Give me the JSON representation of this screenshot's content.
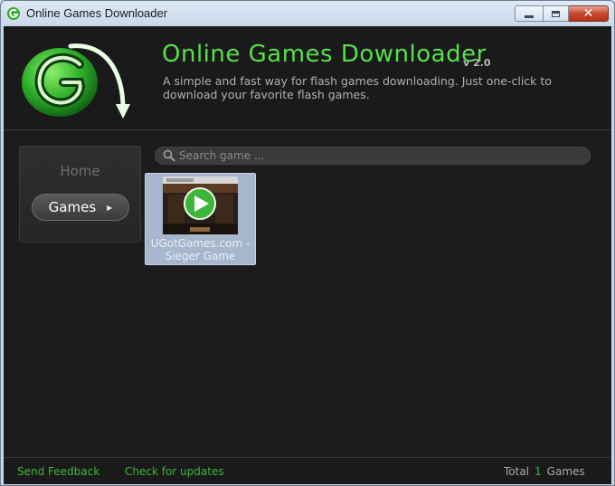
{
  "window": {
    "title": "Online Games Downloader"
  },
  "header": {
    "app_title": "Online Games Downloader",
    "version": "v 2.0",
    "tagline": "A simple and fast way for flash games downloading. Just one-click to download your favorite flash games.",
    "brand_color": "#57e04a"
  },
  "nav": {
    "items": [
      {
        "label": "Home",
        "active": false
      },
      {
        "label": "Games",
        "active": true
      }
    ]
  },
  "search": {
    "placeholder": "Search game ...",
    "value": ""
  },
  "games": [
    {
      "title": "UGotGames.com - Sieger Game",
      "icon": "play-icon",
      "selected": true
    }
  ],
  "footer": {
    "send_feedback": "Send Feedback",
    "check_updates": "Check for updates",
    "total_label": "Total",
    "total_count": "1",
    "games_label": "Games"
  },
  "icons": {
    "app": "g-logo-icon",
    "search": "search-icon",
    "play": "play-icon",
    "minimize": "minimize-icon",
    "maximize": "maximize-icon",
    "close": "close-icon"
  }
}
